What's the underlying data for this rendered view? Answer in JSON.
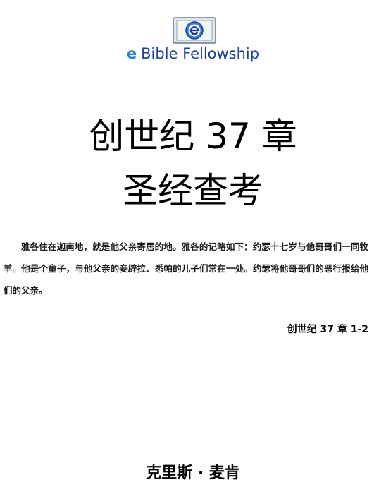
{
  "header": {
    "logo_icon": "e-book-logo-icon",
    "brand_e": "e",
    "brand_name": "Bible Fellowship"
  },
  "title": {
    "line1": "创世纪 37 章",
    "line2": "圣经查考"
  },
  "passage": "雅各住在迦南地，就是他父亲寄居的地。雅各的记略如下：约瑟十七岁与他哥哥们一同牧羊。他是个童子，与他父亲的妾辟拉、悉帕的儿子们常在一处。约瑟将他哥哥们的恶行报给他们的父亲。",
  "reference": "创世纪 37 章 1-2",
  "author": "克里斯 · 麦肯",
  "colors": {
    "brand_blue": "#1c3f9c",
    "logo_blue": "#2f7fd6"
  }
}
